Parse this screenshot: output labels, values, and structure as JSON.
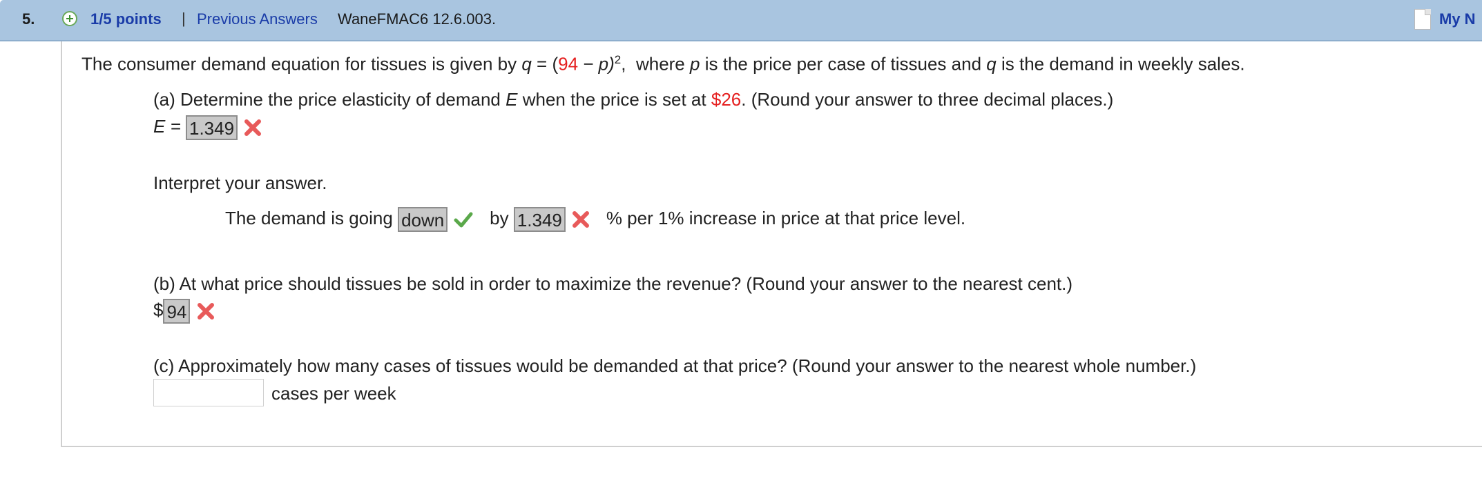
{
  "header": {
    "question_number": "5.",
    "points": "1/5 points",
    "separator": "|",
    "previous_answers": "Previous Answers",
    "problem_code": "WaneFMAC6 12.6.003.",
    "my_notes": "My N"
  },
  "problem": {
    "intro_before": "The consumer demand equation for tissues is given by",
    "q_var": "q",
    "equals_open": " = (",
    "const": "94",
    "minus_p": " − p)",
    "exponent": "2",
    "comma": ",",
    "intro_after": "where",
    "p_var": "p",
    "mid_text": "is the price per case of tissues and",
    "q_var2": "q",
    "end_text": "is the demand in weekly sales."
  },
  "part_a": {
    "prompt_before": "(a) Determine the price elasticity of demand",
    "E_var": "E",
    "prompt_mid": "when the price is set at",
    "price": "$26",
    "prompt_after": ". (Round your answer to three decimal places.)",
    "answer_label": "E =",
    "answer_value": "1.349",
    "interpret_label": "Interpret your answer.",
    "sentence_start": "The demand is going",
    "direction_value": "down",
    "by_label": "by",
    "percent_value": "1.349",
    "sentence_end": "% per 1% increase in price at that price level."
  },
  "part_b": {
    "prompt": "(b) At what price should tissues be sold in order to maximize the revenue? (Round your answer to the nearest cent.)",
    "currency": "$",
    "answer_value": "94"
  },
  "part_c": {
    "prompt": "(c) Approximately how many cases of tissues would be demanded at that price? (Round your answer to the nearest whole number.)",
    "answer_value": "",
    "unit": "cases per week"
  },
  "icons": {
    "incorrect": "x-mark-icon",
    "correct": "check-mark-icon",
    "plus": "plus-circle-icon",
    "notes": "note-icon"
  },
  "colors": {
    "header_bg": "#a9c5e0",
    "link": "#1a3ca8",
    "highlight_red": "#e52020",
    "incorrect": "#e85a5a",
    "correct": "#5aa84a"
  }
}
